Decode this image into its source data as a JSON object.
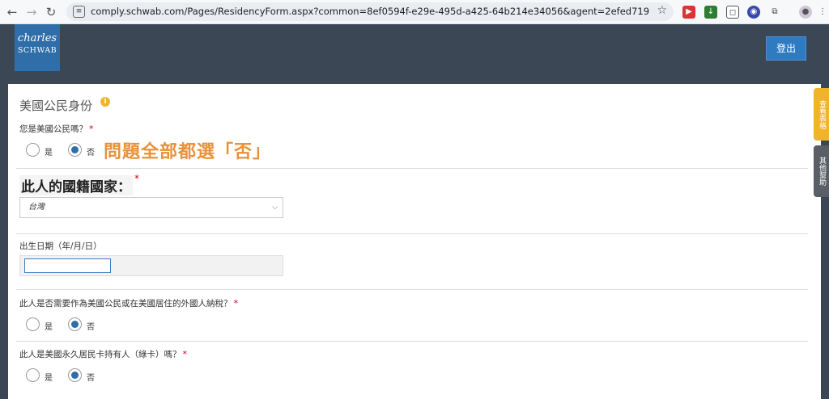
{
  "browser": {
    "url": "comply.schwab.com/Pages/ResidencyForm.aspx?common=8ef0594f-e29e-495d-a425-64b214e34056&agent=2efed719-88f0-4e78-9939-b..."
  },
  "header": {
    "logo_top": "charles",
    "logo_bottom": "SCHWAB",
    "logout_label": "登出"
  },
  "side_tabs": {
    "view_form": "查看表格",
    "help": "其他幫助"
  },
  "form": {
    "section_title": "美國公民身份",
    "annotation": "問題全部都選「否」",
    "q1": {
      "label": "您是美國公民嗎？",
      "yes": "是",
      "no": "否",
      "selected": "no"
    },
    "nationality": {
      "label": "此人的國籍國家：",
      "value": "台灣"
    },
    "dob": {
      "label": "出生日期（年/月/日）",
      "value": ""
    },
    "q3": {
      "label": "此人是否需要作為美國公民或在美國居住的外國人納稅？",
      "yes": "是",
      "no": "否",
      "selected": "no"
    },
    "q4": {
      "label": "此人是美國永久居民卡持有人（綠卡）嗎？",
      "yes": "是",
      "no": "否",
      "selected": "no"
    },
    "required_mark": "*"
  },
  "colors": {
    "header_bg": "#3b4754",
    "brand_blue": "#2f6ea8",
    "annotation_orange": "#e8923a",
    "required_red": "#d0021b"
  }
}
